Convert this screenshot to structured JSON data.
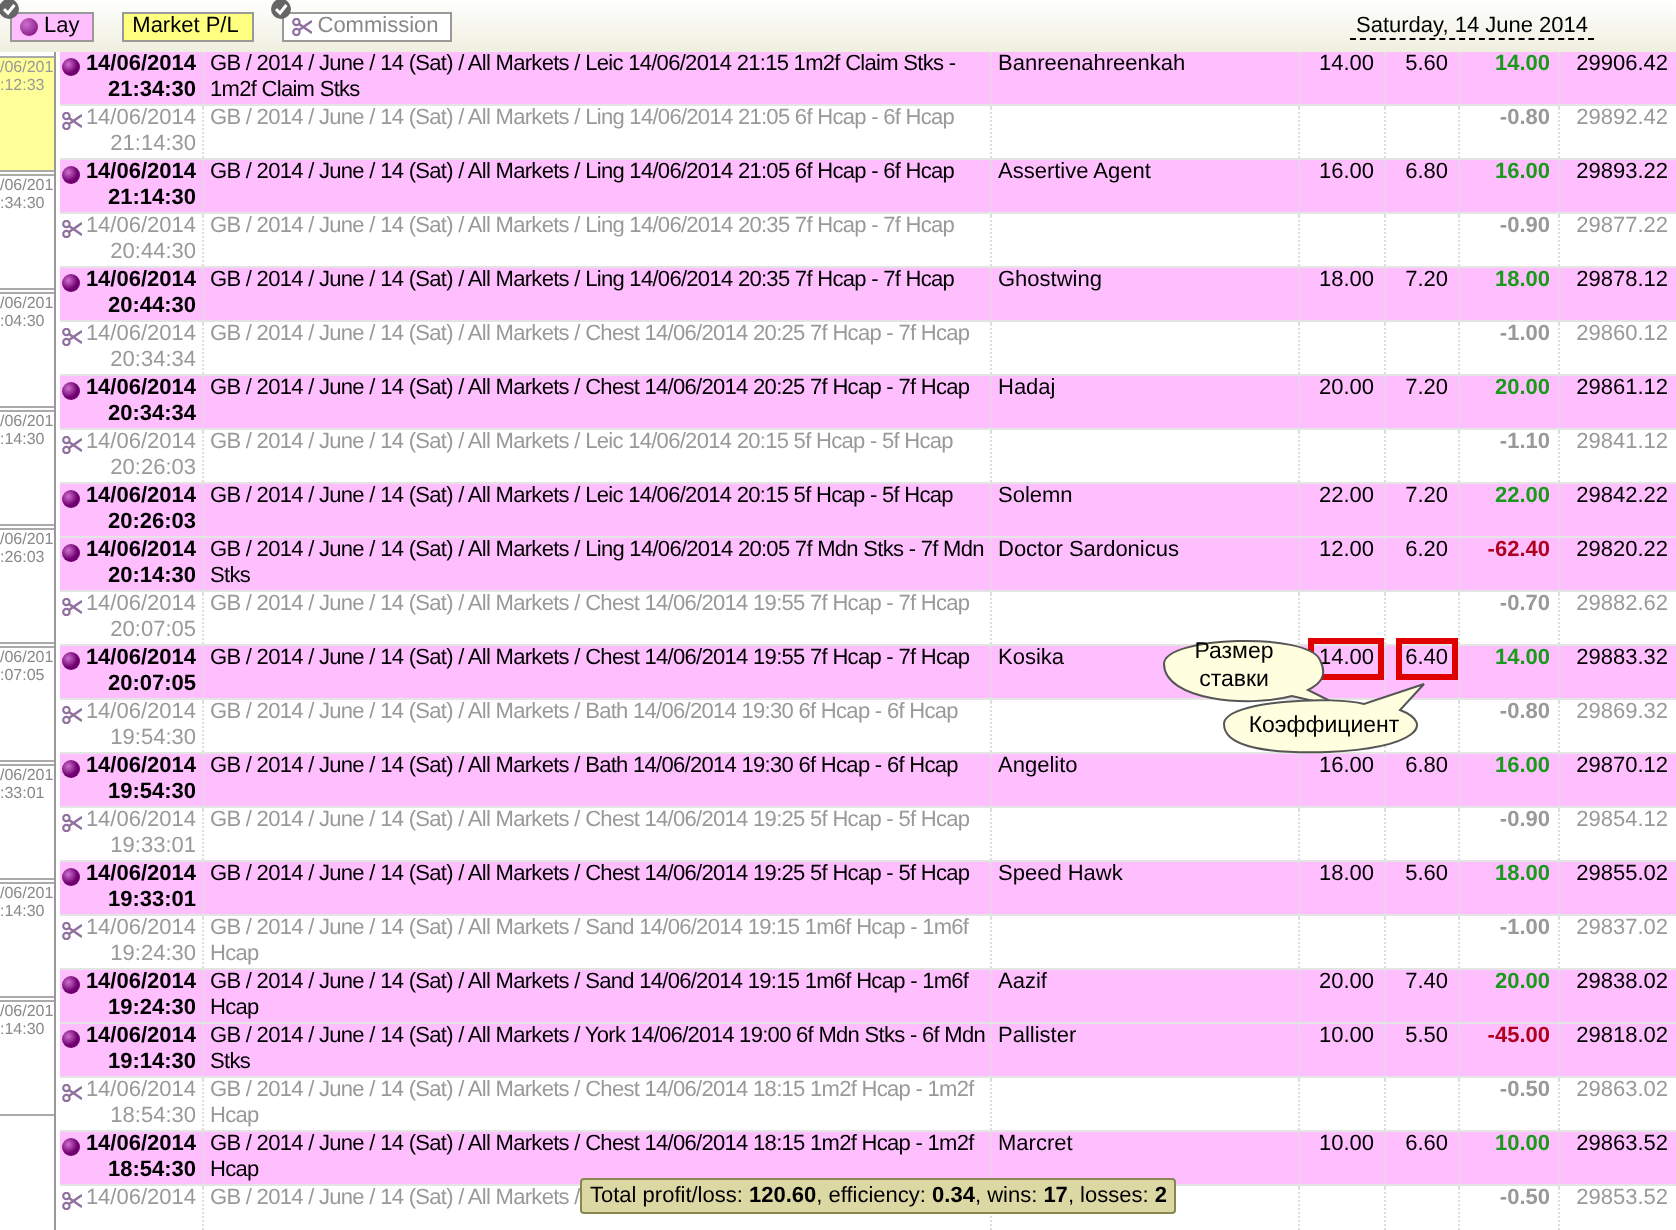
{
  "filters": [
    {
      "label": "Lay",
      "kind": "lay",
      "checked": true
    },
    {
      "label": "Market P/L",
      "kind": "market",
      "checked": false
    },
    {
      "label": "Commission",
      "kind": "commission",
      "checked": true
    }
  ],
  "date_heading": "Saturday, 14 June 2014",
  "side_items": [
    {
      "date": "/06/201",
      "time": ":12:33",
      "selected": true
    },
    {
      "date": "/06/201",
      "time": ":34:30",
      "selected": false
    },
    {
      "date": "/06/201",
      "time": ":04:30",
      "selected": false
    },
    {
      "date": "/06/201",
      "time": ":14:30",
      "selected": false
    },
    {
      "date": "/06/201",
      "time": ":26:03",
      "selected": false
    },
    {
      "date": "/06/201",
      "time": ":07:05",
      "selected": false
    },
    {
      "date": "/06/201",
      "time": ":33:01",
      "selected": false
    },
    {
      "date": "/06/201",
      "time": ":14:30",
      "selected": false
    },
    {
      "date": "/06/201",
      "time": ":14:30",
      "selected": false
    }
  ],
  "rows": [
    {
      "kind": "bet",
      "date": "14/06/2014",
      "time": "21:34:30",
      "market": "GB / 2014 / June / 14 (Sat) / All Markets / Leic 14/06/2014 21:15 1m2f Claim Stks - 1m2f Claim Stks",
      "selection": "Banreenahreenkah",
      "stake": "14.00",
      "odds": "5.60",
      "color": "#1a9a1a",
      "pl": "14.00",
      "balance": "29906.42"
    },
    {
      "kind": "commission",
      "date": "14/06/2014",
      "time": "21:14:30",
      "market": "GB / 2014 / June / 14 (Sat) / All Markets / Ling 14/06/2014 21:05 6f Hcap - 6f Hcap",
      "pl": "-0.80",
      "balance": "29892.42"
    },
    {
      "kind": "bet",
      "date": "14/06/2014",
      "time": "21:14:30",
      "market": "GB / 2014 / June / 14 (Sat) / All Markets / Ling 14/06/2014 21:05 6f Hcap - 6f Hcap",
      "selection": "Assertive Agent",
      "stake": "16.00",
      "odds": "6.80",
      "color": "#1a9a1a",
      "pl": "16.00",
      "balance": "29893.22"
    },
    {
      "kind": "commission",
      "date": "14/06/2014",
      "time": "20:44:30",
      "market": "GB / 2014 / June / 14 (Sat) / All Markets / Ling 14/06/2014 20:35 7f Hcap - 7f Hcap",
      "pl": "-0.90",
      "balance": "29877.22"
    },
    {
      "kind": "bet",
      "date": "14/06/2014",
      "time": "20:44:30",
      "market": "GB / 2014 / June / 14 (Sat) / All Markets / Ling 14/06/2014 20:35 7f Hcap - 7f Hcap",
      "selection": "Ghostwing",
      "stake": "18.00",
      "odds": "7.20",
      "color": "#1a9a1a",
      "pl": "18.00",
      "balance": "29878.12"
    },
    {
      "kind": "commission",
      "date": "14/06/2014",
      "time": "20:34:34",
      "market": "GB / 2014 / June / 14 (Sat) / All Markets / Chest 14/06/2014 20:25 7f Hcap - 7f Hcap",
      "pl": "-1.00",
      "balance": "29860.12"
    },
    {
      "kind": "bet",
      "date": "14/06/2014",
      "time": "20:34:34",
      "market": "GB / 2014 / June / 14 (Sat) / All Markets / Chest 14/06/2014 20:25 7f Hcap - 7f Hcap",
      "selection": "Hadaj",
      "stake": "20.00",
      "odds": "7.20",
      "color": "#1a9a1a",
      "pl": "20.00",
      "balance": "29861.12"
    },
    {
      "kind": "commission",
      "date": "14/06/2014",
      "time": "20:26:03",
      "market": "GB / 2014 / June / 14 (Sat) / All Markets / Leic 14/06/2014 20:15 5f Hcap - 5f Hcap",
      "pl": "-1.10",
      "balance": "29841.12"
    },
    {
      "kind": "bet",
      "date": "14/06/2014",
      "time": "20:26:03",
      "market": "GB / 2014 / June / 14 (Sat) / All Markets / Leic 14/06/2014 20:15 5f Hcap - 5f Hcap",
      "selection": "Solemn",
      "stake": "22.00",
      "odds": "7.20",
      "color": "#1a9a1a",
      "pl": "22.00",
      "balance": "29842.22"
    },
    {
      "kind": "bet",
      "date": "14/06/2014",
      "time": "20:14:30",
      "market": "GB / 2014 / June / 14 (Sat) / All Markets / Ling 14/06/2014 20:05 7f Mdn Stks - 7f Mdn Stks",
      "selection": "Doctor Sardonicus",
      "stake": "12.00",
      "odds": "6.20",
      "color": "#b00020",
      "pl": "-62.40",
      "balance": "29820.22"
    },
    {
      "kind": "commission",
      "date": "14/06/2014",
      "time": "20:07:05",
      "market": "GB / 2014 / June / 14 (Sat) / All Markets / Chest 14/06/2014 19:55 7f Hcap - 7f Hcap",
      "pl": "-0.70",
      "balance": "29882.62"
    },
    {
      "kind": "bet",
      "date": "14/06/2014",
      "time": "20:07:05",
      "market": "GB / 2014 / June / 14 (Sat) / All Markets / Chest 14/06/2014 19:55 7f Hcap - 7f Hcap",
      "selection": "Kosika",
      "stake": "14.00",
      "odds": "6.40",
      "color": "#1a9a1a",
      "pl": "14.00",
      "balance": "29883.32",
      "marked": true
    },
    {
      "kind": "commission",
      "date": "14/06/2014",
      "time": "19:54:30",
      "market": "GB / 2014 / June / 14 (Sat) / All Markets / Bath 14/06/2014 19:30 6f Hcap - 6f Hcap",
      "pl": "-0.80",
      "balance": "29869.32"
    },
    {
      "kind": "bet",
      "date": "14/06/2014",
      "time": "19:54:30",
      "market": "GB / 2014 / June / 14 (Sat) / All Markets / Bath 14/06/2014 19:30 6f Hcap - 6f Hcap",
      "selection": "Angelito",
      "stake": "16.00",
      "odds": "6.80",
      "color": "#1a9a1a",
      "pl": "16.00",
      "balance": "29870.12"
    },
    {
      "kind": "commission",
      "date": "14/06/2014",
      "time": "19:33:01",
      "market": "GB / 2014 / June / 14 (Sat) / All Markets / Chest 14/06/2014 19:25 5f Hcap - 5f Hcap",
      "pl": "-0.90",
      "balance": "29854.12"
    },
    {
      "kind": "bet",
      "date": "14/06/2014",
      "time": "19:33:01",
      "market": "GB / 2014 / June / 14 (Sat) / All Markets / Chest 14/06/2014 19:25 5f Hcap - 5f Hcap",
      "selection": "Speed Hawk",
      "stake": "18.00",
      "odds": "5.60",
      "color": "#1a9a1a",
      "pl": "18.00",
      "balance": "29855.02"
    },
    {
      "kind": "commission",
      "date": "14/06/2014",
      "time": "19:24:30",
      "market": "GB / 2014 / June / 14 (Sat) / All Markets / Sand 14/06/2014 19:15 1m6f Hcap - 1m6f Hcap",
      "pl": "-1.00",
      "balance": "29837.02"
    },
    {
      "kind": "bet",
      "date": "14/06/2014",
      "time": "19:24:30",
      "market": "GB / 2014 / June / 14 (Sat) / All Markets / Sand 14/06/2014 19:15 1m6f Hcap - 1m6f Hcap",
      "selection": "Aazif",
      "stake": "20.00",
      "odds": "7.40",
      "color": "#1a9a1a",
      "pl": "20.00",
      "balance": "29838.02"
    },
    {
      "kind": "bet",
      "date": "14/06/2014",
      "time": "19:14:30",
      "market": "GB / 2014 / June / 14 (Sat) / All Markets / York 14/06/2014 19:00 6f Mdn Stks - 6f Mdn Stks",
      "selection": "Pallister",
      "stake": "10.00",
      "odds": "5.50",
      "color": "#b00020",
      "pl": "-45.00",
      "balance": "29818.02"
    },
    {
      "kind": "commission",
      "date": "14/06/2014",
      "time": "18:54:30",
      "market": "GB / 2014 / June / 14 (Sat) / All Markets / Chest 14/06/2014 18:15 1m2f Hcap - 1m2f Hcap",
      "pl": "-0.50",
      "balance": "29863.02"
    },
    {
      "kind": "bet",
      "date": "14/06/2014",
      "time": "18:54:30",
      "market": "GB / 2014 / June / 14 (Sat) / All Markets / Chest 14/06/2014 18:15 1m2f Hcap - 1m2f Hcap",
      "selection": "Marcret",
      "stake": "10.00",
      "odds": "6.60",
      "color": "#1a9a1a",
      "pl": "10.00",
      "balance": "29863.52"
    },
    {
      "kind": "commission",
      "date": "14/06/2014",
      "market": "GB / 2014 / June / 14 (Sat) / All Markets /",
      "pl": "-0.50",
      "balance": "29853.52"
    }
  ],
  "callouts": [
    {
      "kind": "stake",
      "text": "Размер ставки"
    },
    {
      "kind": "odds",
      "text": "Коэффициент"
    }
  ],
  "summary": "Total profit/loss: **120.60**, efficiency: **0.34**, wins: **17**, losses: **2**"
}
